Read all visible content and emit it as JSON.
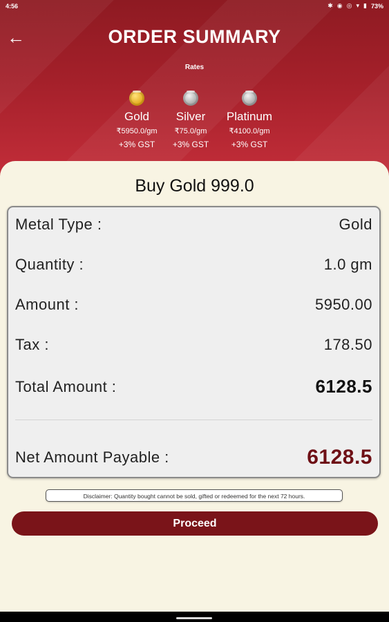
{
  "status": {
    "time": "4:56",
    "battery": "73%"
  },
  "header": {
    "title": "ORDER SUMMARY",
    "rates_label": "Rates",
    "metals": [
      {
        "name": "Gold",
        "price": "₹5950.0/gm",
        "gst": "+3% GST"
      },
      {
        "name": "Silver",
        "price": "₹75.0/gm",
        "gst": "+3% GST"
      },
      {
        "name": "Platinum",
        "price": "₹4100.0/gm",
        "gst": "+3% GST"
      }
    ]
  },
  "order": {
    "title": "Buy Gold 999.0",
    "rows": [
      {
        "label": "Metal Type :",
        "value": "Gold"
      },
      {
        "label": "Quantity :",
        "value": "1.0 gm"
      },
      {
        "label": "Amount :",
        "value": "5950.00"
      },
      {
        "label": "Tax :",
        "value": "178.50"
      },
      {
        "label": "Total Amount :",
        "value": "6128.5"
      }
    ],
    "net_label": "Net Amount Payable :",
    "net_value": "6128.5"
  },
  "disclaimer": "Disclaimer: Quantity bought cannot be sold, gifted or redeemed for the next 72 hours.",
  "proceed_label": "Proceed",
  "colors": {
    "header": "#a4202a",
    "accent": "#7a1419",
    "net_value": "#6e0f15",
    "background": "#f8f4e3"
  },
  "icons": [
    "back-arrow-icon",
    "gold-coin-icon",
    "silver-coin-icon",
    "platinum-coin-icon",
    "bluetooth-icon",
    "wifi-icon",
    "battery-icon"
  ]
}
